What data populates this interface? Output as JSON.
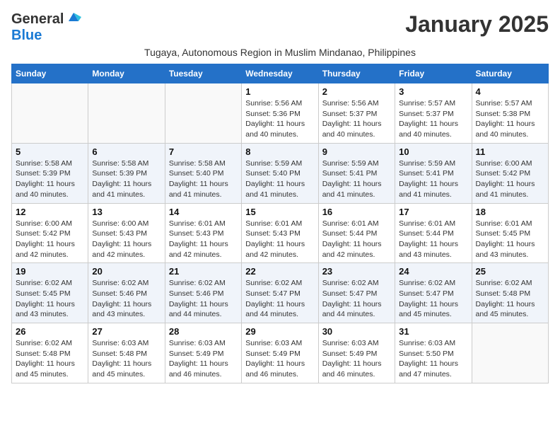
{
  "header": {
    "logo_general": "General",
    "logo_blue": "Blue",
    "month_title": "January 2025",
    "subtitle": "Tugaya, Autonomous Region in Muslim Mindanao, Philippines"
  },
  "weekdays": [
    "Sunday",
    "Monday",
    "Tuesday",
    "Wednesday",
    "Thursday",
    "Friday",
    "Saturday"
  ],
  "weeks": [
    [
      {
        "day": "",
        "info": ""
      },
      {
        "day": "",
        "info": ""
      },
      {
        "day": "",
        "info": ""
      },
      {
        "day": "1",
        "info": "Sunrise: 5:56 AM\nSunset: 5:36 PM\nDaylight: 11 hours and 40 minutes."
      },
      {
        "day": "2",
        "info": "Sunrise: 5:56 AM\nSunset: 5:37 PM\nDaylight: 11 hours and 40 minutes."
      },
      {
        "day": "3",
        "info": "Sunrise: 5:57 AM\nSunset: 5:37 PM\nDaylight: 11 hours and 40 minutes."
      },
      {
        "day": "4",
        "info": "Sunrise: 5:57 AM\nSunset: 5:38 PM\nDaylight: 11 hours and 40 minutes."
      }
    ],
    [
      {
        "day": "5",
        "info": "Sunrise: 5:58 AM\nSunset: 5:39 PM\nDaylight: 11 hours and 40 minutes."
      },
      {
        "day": "6",
        "info": "Sunrise: 5:58 AM\nSunset: 5:39 PM\nDaylight: 11 hours and 41 minutes."
      },
      {
        "day": "7",
        "info": "Sunrise: 5:58 AM\nSunset: 5:40 PM\nDaylight: 11 hours and 41 minutes."
      },
      {
        "day": "8",
        "info": "Sunrise: 5:59 AM\nSunset: 5:40 PM\nDaylight: 11 hours and 41 minutes."
      },
      {
        "day": "9",
        "info": "Sunrise: 5:59 AM\nSunset: 5:41 PM\nDaylight: 11 hours and 41 minutes."
      },
      {
        "day": "10",
        "info": "Sunrise: 5:59 AM\nSunset: 5:41 PM\nDaylight: 11 hours and 41 minutes."
      },
      {
        "day": "11",
        "info": "Sunrise: 6:00 AM\nSunset: 5:42 PM\nDaylight: 11 hours and 41 minutes."
      }
    ],
    [
      {
        "day": "12",
        "info": "Sunrise: 6:00 AM\nSunset: 5:42 PM\nDaylight: 11 hours and 42 minutes."
      },
      {
        "day": "13",
        "info": "Sunrise: 6:00 AM\nSunset: 5:43 PM\nDaylight: 11 hours and 42 minutes."
      },
      {
        "day": "14",
        "info": "Sunrise: 6:01 AM\nSunset: 5:43 PM\nDaylight: 11 hours and 42 minutes."
      },
      {
        "day": "15",
        "info": "Sunrise: 6:01 AM\nSunset: 5:43 PM\nDaylight: 11 hours and 42 minutes."
      },
      {
        "day": "16",
        "info": "Sunrise: 6:01 AM\nSunset: 5:44 PM\nDaylight: 11 hours and 42 minutes."
      },
      {
        "day": "17",
        "info": "Sunrise: 6:01 AM\nSunset: 5:44 PM\nDaylight: 11 hours and 43 minutes."
      },
      {
        "day": "18",
        "info": "Sunrise: 6:01 AM\nSunset: 5:45 PM\nDaylight: 11 hours and 43 minutes."
      }
    ],
    [
      {
        "day": "19",
        "info": "Sunrise: 6:02 AM\nSunset: 5:45 PM\nDaylight: 11 hours and 43 minutes."
      },
      {
        "day": "20",
        "info": "Sunrise: 6:02 AM\nSunset: 5:46 PM\nDaylight: 11 hours and 43 minutes."
      },
      {
        "day": "21",
        "info": "Sunrise: 6:02 AM\nSunset: 5:46 PM\nDaylight: 11 hours and 44 minutes."
      },
      {
        "day": "22",
        "info": "Sunrise: 6:02 AM\nSunset: 5:47 PM\nDaylight: 11 hours and 44 minutes."
      },
      {
        "day": "23",
        "info": "Sunrise: 6:02 AM\nSunset: 5:47 PM\nDaylight: 11 hours and 44 minutes."
      },
      {
        "day": "24",
        "info": "Sunrise: 6:02 AM\nSunset: 5:47 PM\nDaylight: 11 hours and 45 minutes."
      },
      {
        "day": "25",
        "info": "Sunrise: 6:02 AM\nSunset: 5:48 PM\nDaylight: 11 hours and 45 minutes."
      }
    ],
    [
      {
        "day": "26",
        "info": "Sunrise: 6:02 AM\nSunset: 5:48 PM\nDaylight: 11 hours and 45 minutes."
      },
      {
        "day": "27",
        "info": "Sunrise: 6:03 AM\nSunset: 5:48 PM\nDaylight: 11 hours and 45 minutes."
      },
      {
        "day": "28",
        "info": "Sunrise: 6:03 AM\nSunset: 5:49 PM\nDaylight: 11 hours and 46 minutes."
      },
      {
        "day": "29",
        "info": "Sunrise: 6:03 AM\nSunset: 5:49 PM\nDaylight: 11 hours and 46 minutes."
      },
      {
        "day": "30",
        "info": "Sunrise: 6:03 AM\nSunset: 5:49 PM\nDaylight: 11 hours and 46 minutes."
      },
      {
        "day": "31",
        "info": "Sunrise: 6:03 AM\nSunset: 5:50 PM\nDaylight: 11 hours and 47 minutes."
      },
      {
        "day": "",
        "info": ""
      }
    ]
  ]
}
